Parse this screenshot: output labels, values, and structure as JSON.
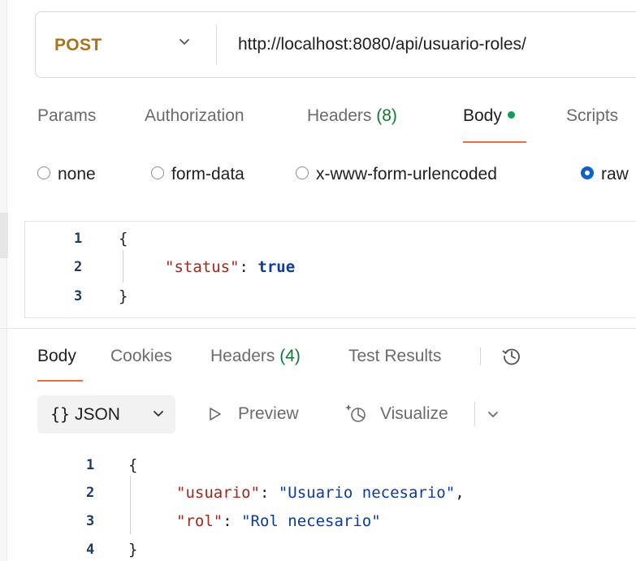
{
  "request": {
    "method": "POST",
    "url": "http://localhost:8080/api/usuario-roles/",
    "tabs": [
      {
        "label": "Params"
      },
      {
        "label": "Authorization"
      },
      {
        "label": "Headers",
        "count": "(8)"
      },
      {
        "label": "Body",
        "active": true
      },
      {
        "label": "Scripts"
      }
    ],
    "body_types": [
      "none",
      "form-data",
      "x-www-form-urlencoded",
      "raw"
    ],
    "body_type_selected": "raw",
    "editor": {
      "line_numbers": [
        "1",
        "2",
        "3"
      ],
      "open_brace": "{",
      "key": "\"status\"",
      "colon": ": ",
      "value": "true",
      "close_brace": "}"
    }
  },
  "response": {
    "tabs": [
      {
        "label": "Body",
        "active": true
      },
      {
        "label": "Cookies"
      },
      {
        "label": "Headers",
        "count": "(4)"
      },
      {
        "label": "Test Results"
      }
    ],
    "toolbar": {
      "format_braces": "{}",
      "format_label": "JSON",
      "preview_label": "Preview",
      "visualize_label": "Visualize"
    },
    "editor": {
      "line_numbers": [
        "1",
        "2",
        "3",
        "4"
      ],
      "open_brace": "{",
      "line2_key": "\"usuario\"",
      "line2_value": "\"Usuario necesario\"",
      "line2_comma": ",",
      "line3_key": "\"rol\"",
      "line3_value": "\"Rol necesario\"",
      "colon": ": ",
      "close_brace": "}"
    }
  },
  "colors": {
    "method": "#a7741b",
    "accent_underline": "#f26b3a",
    "status_dot": "#0f9d58",
    "count": "#0f7a34",
    "radio_selected": "#0c62c7",
    "json_key": "#a3271b",
    "json_value": "#0b3aa3"
  },
  "icons": [
    "chevron-down-icon",
    "history-icon",
    "preview-play-icon",
    "visualize-icon"
  ]
}
